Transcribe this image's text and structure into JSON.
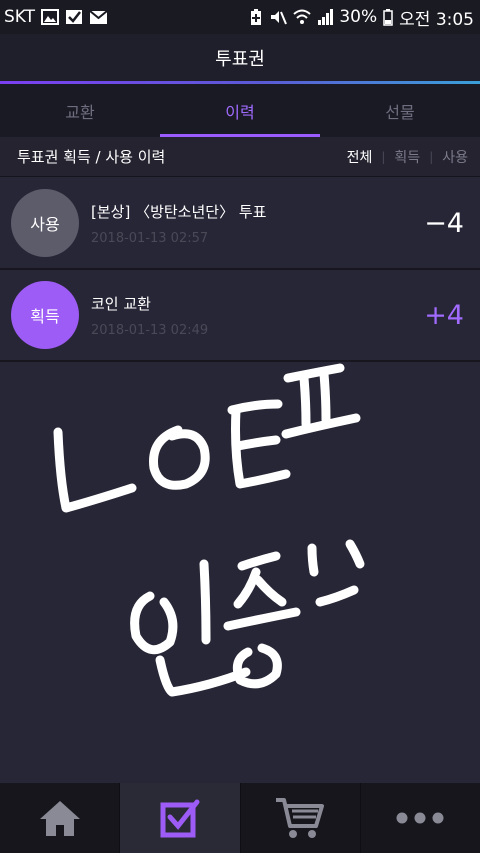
{
  "status_bar": {
    "carrier": "SKT",
    "battery": "30%",
    "time": "오전 3:05",
    "left_icons": [
      "gallery-icon",
      "check-notification-icon",
      "mail-icon"
    ],
    "right_icons": [
      "battery-saver-icon",
      "mute-icon",
      "wifi-icon",
      "signal-icon",
      "battery-icon"
    ]
  },
  "header": {
    "title": "투표권"
  },
  "tabs": [
    {
      "label": "교환",
      "active": false
    },
    {
      "label": "이력",
      "active": true
    },
    {
      "label": "선물",
      "active": false
    }
  ],
  "section": {
    "title": "투표권 획득 / 사용 이력",
    "filters": [
      {
        "label": "전체",
        "active": true
      },
      {
        "label": "획득",
        "active": false
      },
      {
        "label": "사용",
        "active": false
      }
    ]
  },
  "history": [
    {
      "badge": "사용",
      "title": "[본상] 〈방탄소년단〉 투표",
      "date": "2018-01-13 02:57",
      "amount": "−4",
      "type": "used"
    },
    {
      "badge": "획득",
      "title": "코인 교환",
      "date": "2018-01-13 02:49",
      "amount": "+4",
      "type": "earned"
    }
  ],
  "bottom_nav": [
    {
      "icon": "home-icon",
      "active": false
    },
    {
      "icon": "vote-check-icon",
      "active": true
    },
    {
      "icon": "cart-icon",
      "active": false
    },
    {
      "icon": "more-icon",
      "active": false
    }
  ],
  "colors": {
    "accent": "#9d5cf5",
    "background": "#272636",
    "used_badge": "#5d5c6b"
  }
}
